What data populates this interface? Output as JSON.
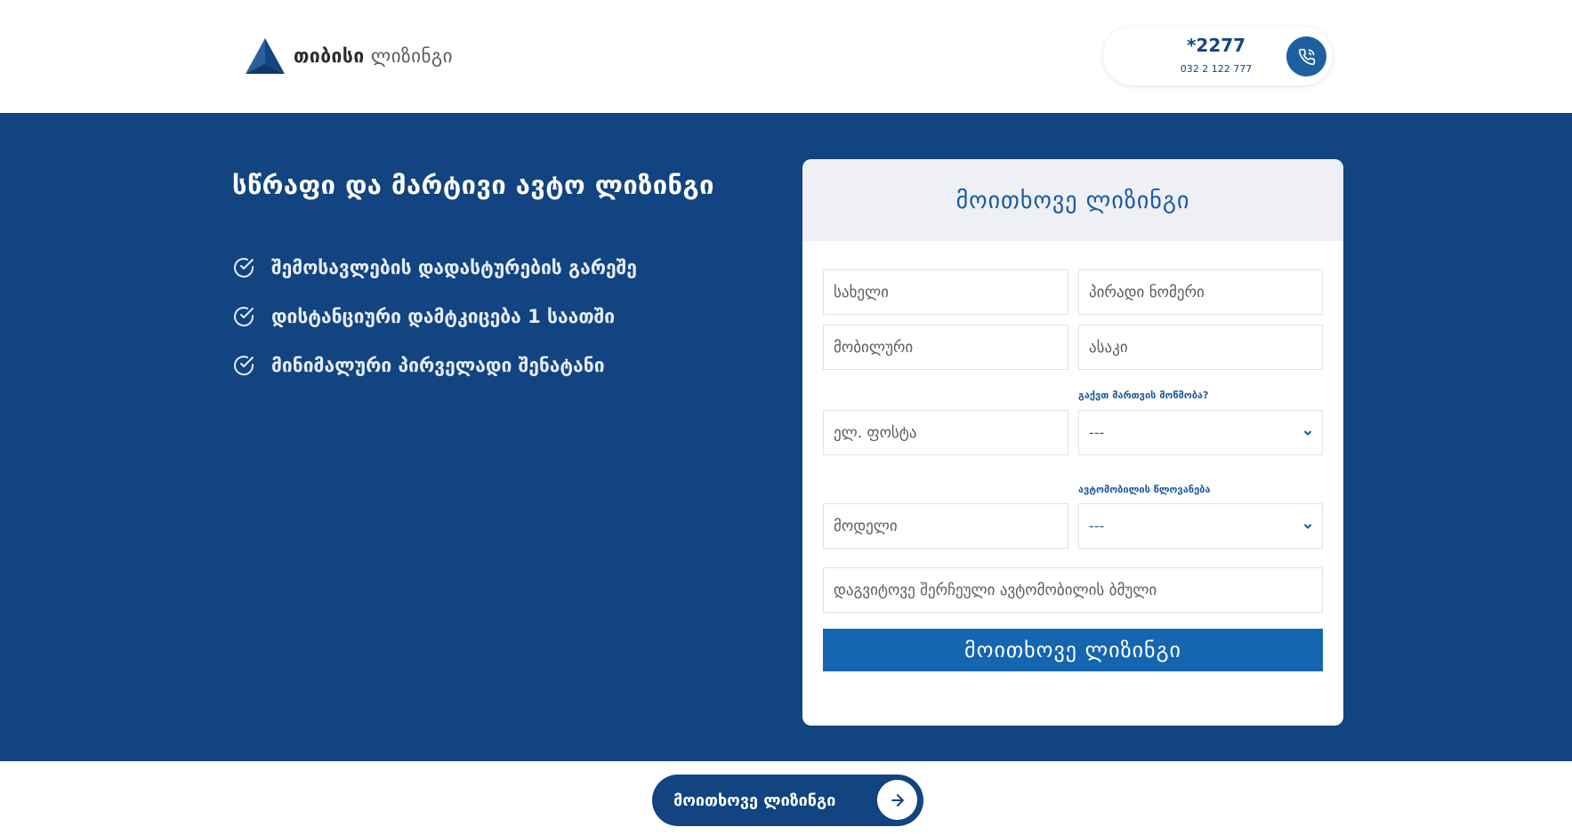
{
  "colors": {
    "primary": "#114480",
    "accent": "#1565b0",
    "card_head": "#eef0f5"
  },
  "header": {
    "logo_bold": "თიბისი",
    "logo_light": "ლიზინგი",
    "phone_short": "*2277",
    "phone_long": "032 2 122 777",
    "phone_icon": "phone-icon"
  },
  "hero": {
    "title": "სწრაფი და მარტივი ავტო ლიზინგი",
    "features": [
      "შემოსავლების დადასტურების გარეშე",
      "დისტანციური დამტკიცება 1 საათში",
      "მინიმალური პირველადი შენატანი"
    ]
  },
  "form": {
    "title": "მოითხოვე ლიზინგი",
    "name_placeholder": "სახელი",
    "id_placeholder": "პირადი ნომერი",
    "mobile_placeholder": "მობილური",
    "age_placeholder": "ასაკი",
    "license_label": "გაქვთ მართვის მოწმობა?",
    "email_placeholder": "ელ. ფოსტა",
    "license_value": "---",
    "car_year_label": "ავტომობილის წლოვანება",
    "model_placeholder": "მოდელი",
    "car_year_value": "---",
    "link_placeholder": "დაგვიტოვე შერჩეული ავტომობილის ბმული",
    "submit_label": "მოითხოვე ლიზინგი"
  },
  "cta": {
    "label": "მოითხოვე ლიზინგი",
    "icon": "arrow-right-icon"
  }
}
